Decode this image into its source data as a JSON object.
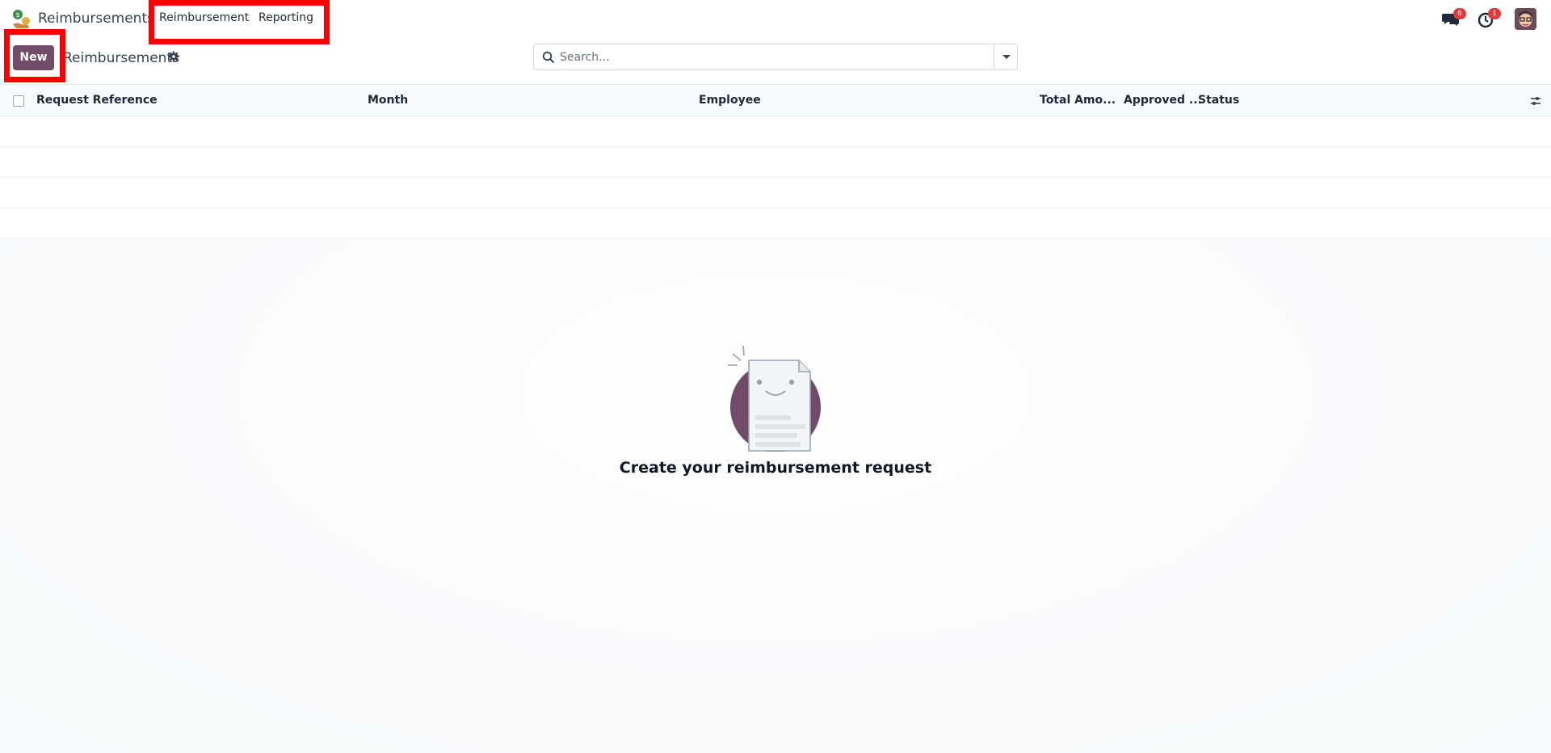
{
  "app": {
    "name": "Reimbursements",
    "logo_icon": "money-hand-icon"
  },
  "menu": {
    "items": [
      {
        "label": "Reimbursement"
      },
      {
        "label": "Reporting"
      }
    ]
  },
  "systray": {
    "messages_badge": "6",
    "activities_badge": "1"
  },
  "controlbar": {
    "new_label": "New",
    "breadcrumb": "Reimbursements"
  },
  "search": {
    "placeholder": "Search..."
  },
  "list": {
    "columns": [
      {
        "label": "Request Reference"
      },
      {
        "label": "Month"
      },
      {
        "label": "Employee"
      },
      {
        "label": "Total Amo..."
      },
      {
        "label": "Approved ..."
      },
      {
        "label": "Status"
      }
    ]
  },
  "empty_state": {
    "title": "Create your reimbursement request"
  },
  "colors": {
    "primary": "#714b67",
    "highlight": "#ff0000",
    "badge": "#e5383b"
  }
}
